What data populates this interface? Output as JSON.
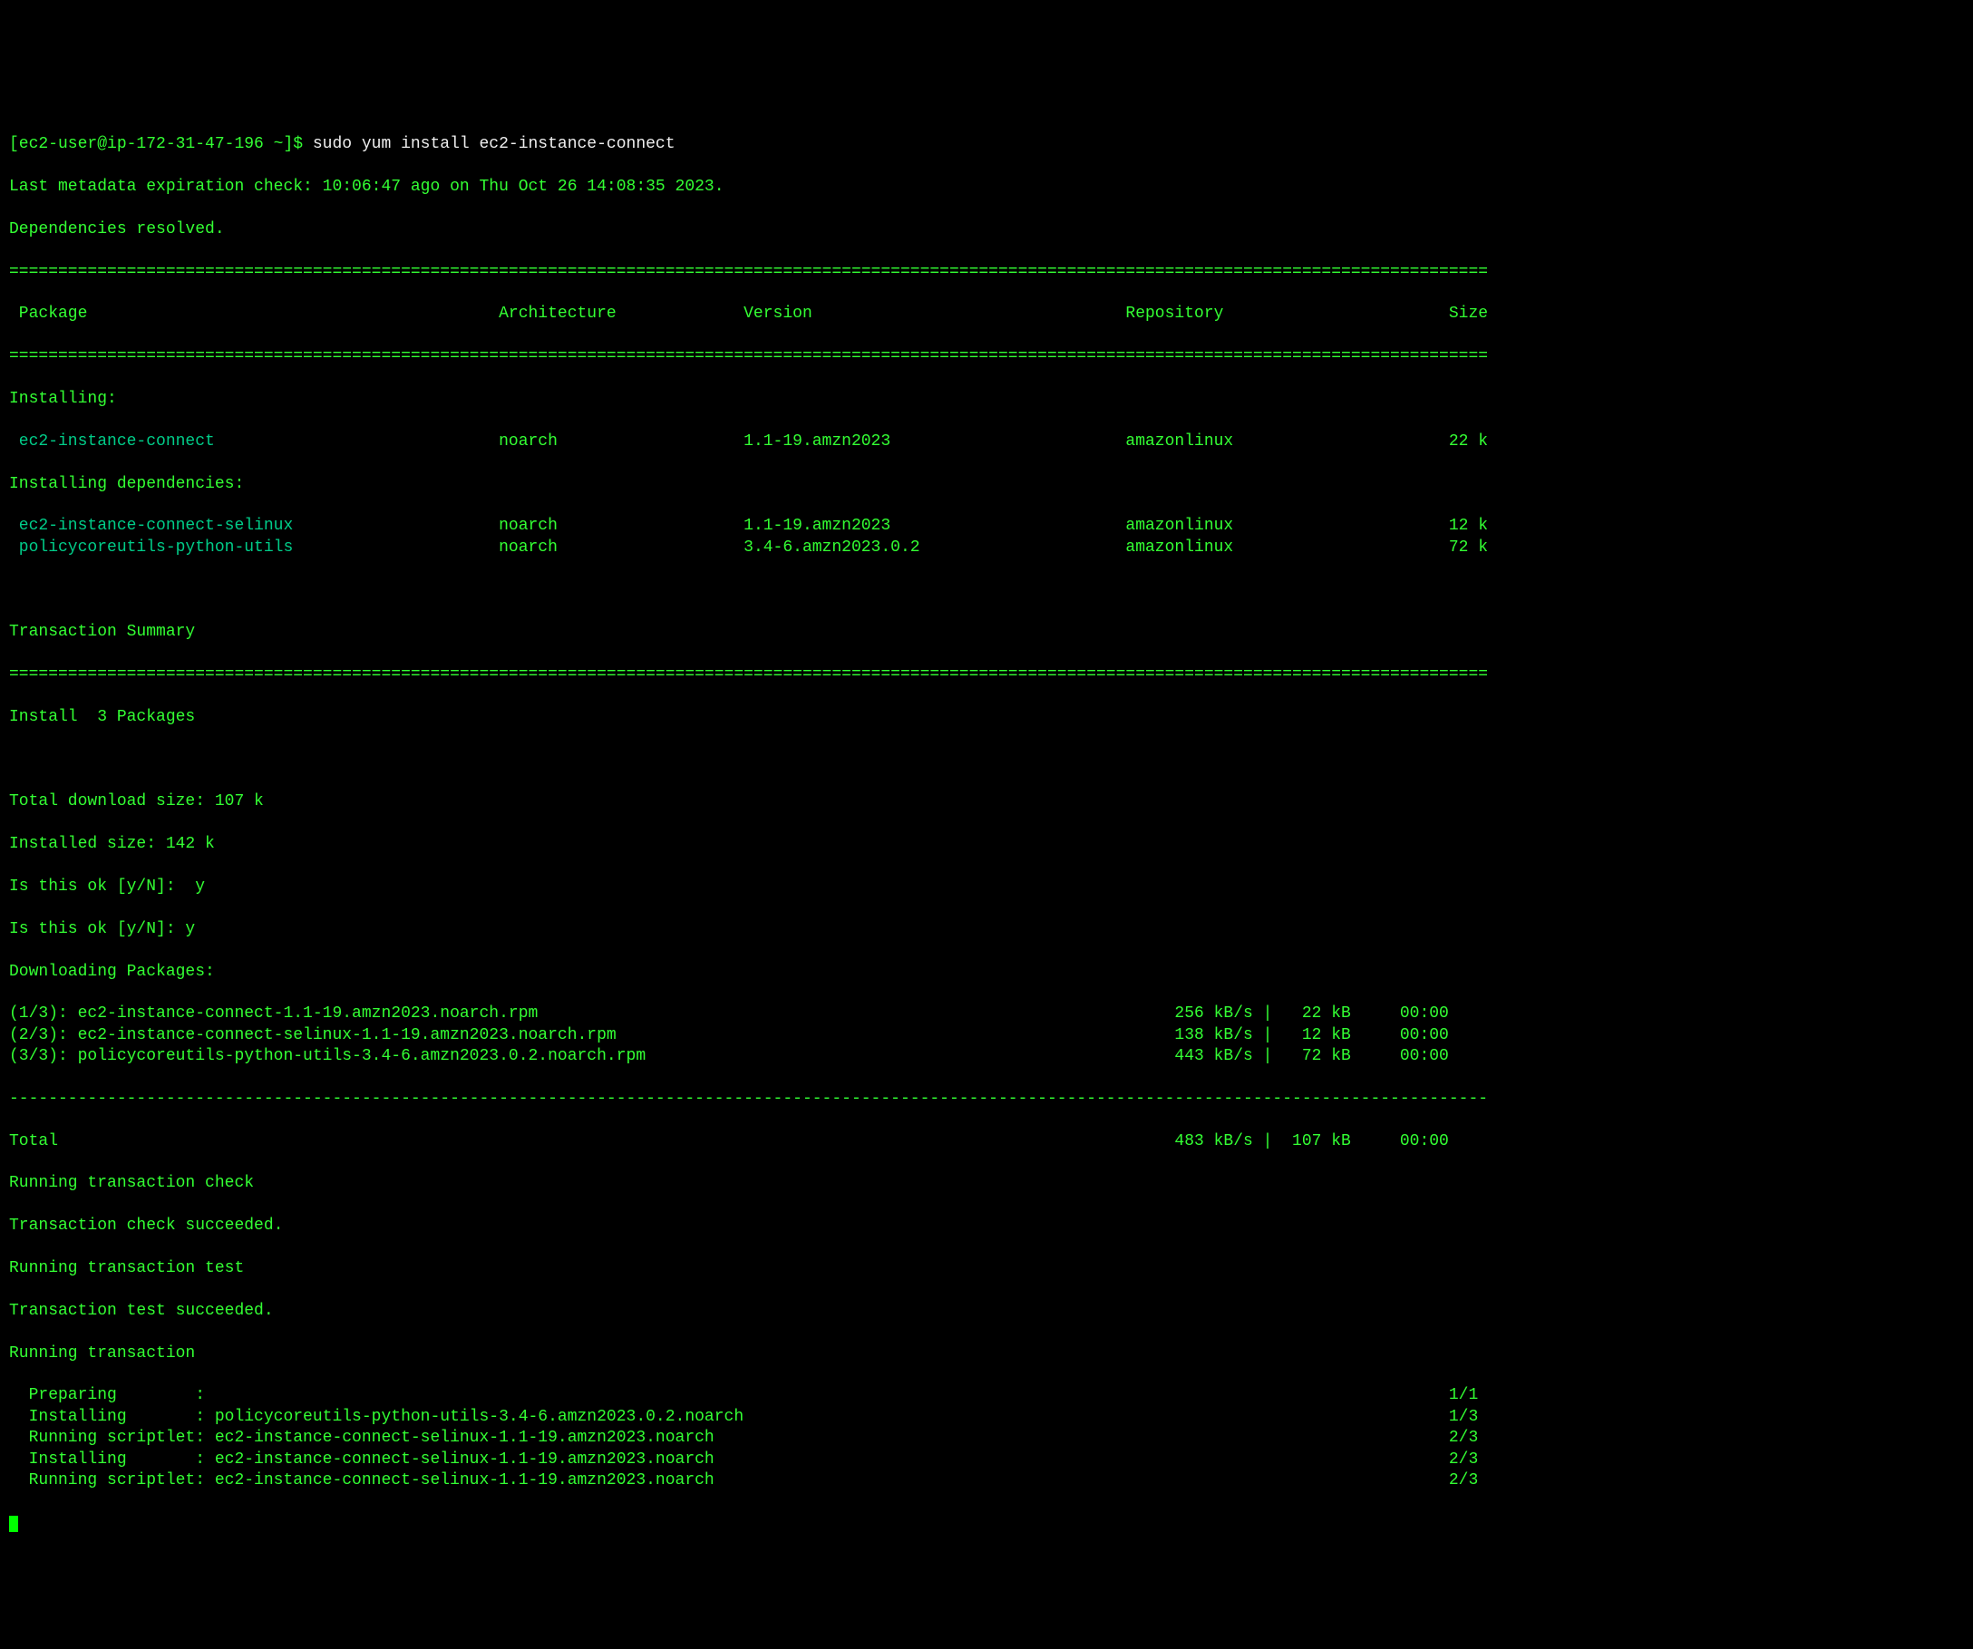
{
  "prompt": {
    "user_host": "[ec2-user@ip-172-31-47-196 ~]$ ",
    "command": "sudo yum install ec2-instance-connect"
  },
  "metadata_line": "Last metadata expiration check: 10:06:47 ago on Thu Oct 26 14:08:35 2023.",
  "deps_resolved": "Dependencies resolved.",
  "hr_eq": "=======================================================================================================================================================",
  "hr_dash": "-------------------------------------------------------------------------------------------------------------------------------------------------------",
  "table_header": {
    "package": " Package",
    "arch": "Architecture",
    "version": "Version",
    "repo": "Repository",
    "size": "Size"
  },
  "section_installing": "Installing:",
  "section_installing_deps": "Installing dependencies:",
  "packages_main": [
    {
      "name": " ec2-instance-connect",
      "arch": "noarch",
      "version": "1.1-19.amzn2023",
      "repo": "amazonlinux",
      "size": "22 k"
    }
  ],
  "packages_deps": [
    {
      "name": " ec2-instance-connect-selinux",
      "arch": "noarch",
      "version": "1.1-19.amzn2023",
      "repo": "amazonlinux",
      "size": "12 k"
    },
    {
      "name": " policycoreutils-python-utils",
      "arch": "noarch",
      "version": "3.4-6.amzn2023.0.2",
      "repo": "amazonlinux",
      "size": "72 k"
    }
  ],
  "tx_summary_label": "Transaction Summary",
  "install_count": "Install  3 Packages",
  "total_download": "Total download size: 107 k",
  "installed_size": "Installed size: 142 k",
  "confirm1": "Is this ok [y/N]:  y",
  "confirm2": "Is this ok [y/N]: y",
  "downloading_label": "Downloading Packages:",
  "downloads": [
    {
      "idx": "(1/3): ",
      "file": "ec2-instance-connect-1.1-19.amzn2023.noarch.rpm",
      "speed": "256 kB/s",
      "size": "22 kB",
      "time": "00:00"
    },
    {
      "idx": "(2/3): ",
      "file": "ec2-instance-connect-selinux-1.1-19.amzn2023.noarch.rpm",
      "speed": "138 kB/s",
      "size": "12 kB",
      "time": "00:00"
    },
    {
      "idx": "(3/3): ",
      "file": "policycoreutils-python-utils-3.4-6.amzn2023.0.2.noarch.rpm",
      "speed": "443 kB/s",
      "size": "72 kB",
      "time": "00:00"
    }
  ],
  "total_line": {
    "label": "Total",
    "speed": "483 kB/s",
    "size": "107 kB",
    "time": "00:00"
  },
  "tx_check_running": "Running transaction check",
  "tx_check_succeeded": "Transaction check succeeded.",
  "tx_test_running": "Running transaction test",
  "tx_test_succeeded": "Transaction test succeeded.",
  "tx_running": "Running transaction",
  "tx_steps": [
    {
      "action": "  Preparing        :",
      "pkg": "",
      "progress": "1/1"
    },
    {
      "action": "  Installing       : ",
      "pkg": "policycoreutils-python-utils-3.4-6.amzn2023.0.2.noarch",
      "progress": "1/3"
    },
    {
      "action": "  Running scriptlet: ",
      "pkg": "ec2-instance-connect-selinux-1.1-19.amzn2023.noarch",
      "progress": "2/3"
    },
    {
      "action": "  Installing       : ",
      "pkg": "ec2-instance-connect-selinux-1.1-19.amzn2023.noarch",
      "progress": "2/3"
    },
    {
      "action": "  Running scriptlet: ",
      "pkg": "ec2-instance-connect-selinux-1.1-19.amzn2023.noarch",
      "progress": "2/3"
    }
  ]
}
